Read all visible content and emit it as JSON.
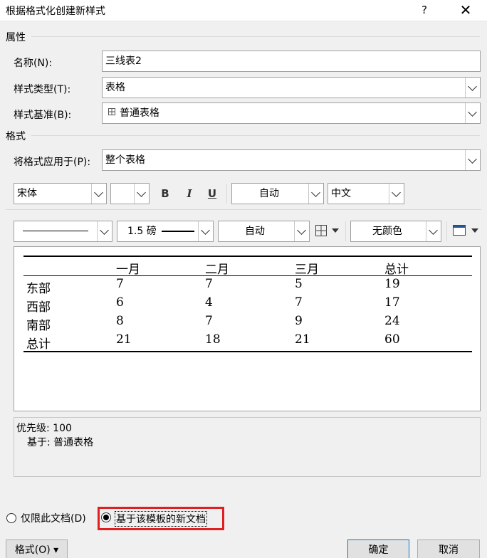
{
  "window": {
    "title": "根据格式化创建新样式",
    "help": "?",
    "close": "✕"
  },
  "properties": {
    "header": "属性",
    "name_label": "名称(N):",
    "name_value": "三线表2",
    "type_label": "样式类型(T):",
    "type_value": "表格",
    "base_label": "样式基准(B):",
    "base_value": "普通表格",
    "base_icon": "table-icon"
  },
  "format": {
    "header": "格式",
    "apply_label": "将格式应用于(P):",
    "apply_value": "整个表格",
    "font": "宋体",
    "font_size": "",
    "bold": "B",
    "italic": "I",
    "underline": "U",
    "color": "自动",
    "script": "中文",
    "border_width": "1.5 磅",
    "border_color": "自动",
    "shading": "无颜色"
  },
  "preview": {
    "headers": [
      "",
      "一月",
      "二月",
      "三月",
      "总计"
    ],
    "rows": [
      [
        "东部",
        "7",
        "7",
        "5",
        "19"
      ],
      [
        "西部",
        "6",
        "4",
        "7",
        "17"
      ],
      [
        "南部",
        "8",
        "7",
        "9",
        "24"
      ],
      [
        "总计",
        "21",
        "18",
        "21",
        "60"
      ]
    ]
  },
  "description": {
    "line1": "优先级: 100",
    "line2": "基于: 普通表格"
  },
  "options": {
    "doc_only": "仅限此文档(D)",
    "template": "基于该模板的新文档",
    "selected": "template"
  },
  "buttons": {
    "format": "格式(O) ▾",
    "ok": "确定",
    "cancel": "取消"
  }
}
